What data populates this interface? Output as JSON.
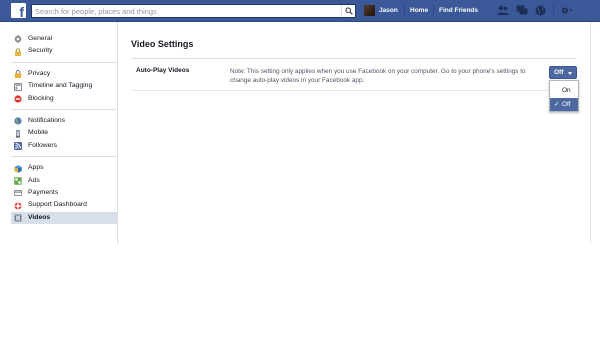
{
  "topbar": {
    "logo": "f",
    "search_placeholder": "Search for people, places and things",
    "user_name": "Jason",
    "home_label": "Home",
    "find_friends_label": "Find Friends"
  },
  "sidebar": {
    "groups": [
      [
        {
          "label": "General",
          "icon": "gear-icon"
        },
        {
          "label": "Security",
          "icon": "lock-icon"
        }
      ],
      [
        {
          "label": "Privacy",
          "icon": "privacy-lock-icon"
        },
        {
          "label": "Timeline and Tagging",
          "icon": "timeline-icon"
        },
        {
          "label": "Blocking",
          "icon": "blocking-icon"
        }
      ],
      [
        {
          "label": "Notifications",
          "icon": "globe-icon"
        },
        {
          "label": "Mobile",
          "icon": "mobile-icon"
        },
        {
          "label": "Followers",
          "icon": "rss-icon"
        }
      ],
      [
        {
          "label": "Apps",
          "icon": "cube-icon"
        },
        {
          "label": "Ads",
          "icon": "ads-icon"
        },
        {
          "label": "Payments",
          "icon": "payments-icon"
        },
        {
          "label": "Support Dashboard",
          "icon": "lifebuoy-icon"
        },
        {
          "label": "Videos",
          "icon": "film-icon"
        }
      ]
    ],
    "active": "Videos"
  },
  "main": {
    "title": "Video Settings",
    "setting_label": "Auto-Play Videos",
    "setting_note": "Note: This setting only applies when you use Facebook on your computer. Go to your phone's settings to change auto-play videos in your Facebook app.",
    "dropdown": {
      "selected": "Off",
      "options": [
        "On",
        "Off"
      ],
      "check_glyph": "✓"
    }
  },
  "colors": {
    "brand": "#3b5998",
    "button": "#4e69a2",
    "active_nav": "#d8dfea"
  }
}
